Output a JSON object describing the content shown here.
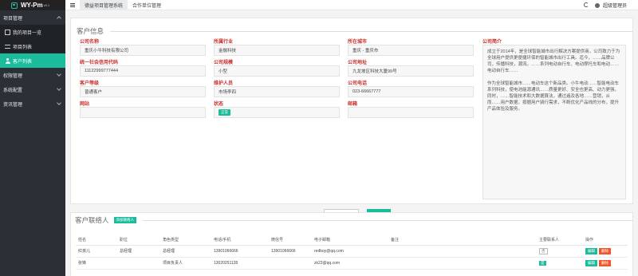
{
  "app": {
    "logo": "WY-Pm",
    "version": "v0.1"
  },
  "sidebar": {
    "items": [
      {
        "label": "项目管理"
      },
      {
        "label": "我的项目一览"
      },
      {
        "label": "项目列表"
      },
      {
        "label": "客户列表"
      },
      {
        "label": "权限管理"
      },
      {
        "label": "系统配置"
      },
      {
        "label": "资讯管理"
      }
    ]
  },
  "topbar": {
    "tabs": [
      {
        "label": "德益项目管理系统"
      },
      {
        "label": "合作单位管理"
      }
    ],
    "user": "超级管理员"
  },
  "customer": {
    "section_title": "客户信息",
    "fields": [
      {
        "label": "公司名称",
        "value": "重庆小牛科技有限公司"
      },
      {
        "label": "所属行业",
        "value": "金融科技"
      },
      {
        "label": "所在城市",
        "value": "重庆 - 重庆市"
      },
      {
        "label": "统一社会信用代码",
        "value": "11122999777444"
      },
      {
        "label": "公司规模",
        "value": "小型"
      },
      {
        "label": "公司地址",
        "value": "九龙坡区科技大厦99号"
      },
      {
        "label": "客户等级",
        "value": "普通客户"
      },
      {
        "label": "维护人员",
        "value": "市场李四"
      },
      {
        "label": "公司电话",
        "value": "023-66667777"
      },
      {
        "label": "网站",
        "value": ""
      },
      {
        "label": "状态",
        "value": "正常"
      },
      {
        "label": "邮箱",
        "value": ""
      }
    ],
    "intro_label": "公司简介",
    "intro_p1": "成立于2014年，是全球智能城市出行解决方案提供商，公司致力于为全球用户提供更便捷环保的智能城市出行工具。迄今，……品牌公司，传播科技，潮流。……系列电动自行车、电动摩托车和电动……电动自行车……",
    "intro_p2": "作为全球智能城市……电动车这个新品类。小牛电动……智能电动车系列科技，使电池能源通讯……质量更好、安全也更高、动力更强。同时，……智能技术和大数据算法，通过遍及各地……营销，从而……用户数据，按据用户骑行需求，不断优化产品线的分布，提升产品体验及服务。"
  },
  "actions": {
    "back": "返回列表",
    "edit": "编辑"
  },
  "contacts": {
    "section_title": "客户联络人",
    "add_label": "添加联络人",
    "headers": [
      "姓名",
      "职位",
      "角色类型",
      "电话/手机",
      "微信号",
      "电子邮箱",
      "备注",
      "主要联系人",
      "操作"
    ],
    "rows": [
      {
        "name": "红孩儿",
        "position": "总经理",
        "role": "总经理",
        "phone": "13901066666",
        "wechat": "13901066666",
        "email": "redboy@qq.com",
        "note": "",
        "primary": "否"
      },
      {
        "name": "张锋",
        "position": "",
        "role": "项目负责人",
        "phone": "13020251128",
        "wechat": "",
        "email": "zk23@qq.com",
        "note": "",
        "primary": "是"
      }
    ],
    "edit_label": "编辑",
    "delete_label": "删除"
  },
  "colors": {
    "accent": "#1abc9c",
    "danger": "#f0552c",
    "label": "#c9302c",
    "sidebar": "#2b3036"
  }
}
